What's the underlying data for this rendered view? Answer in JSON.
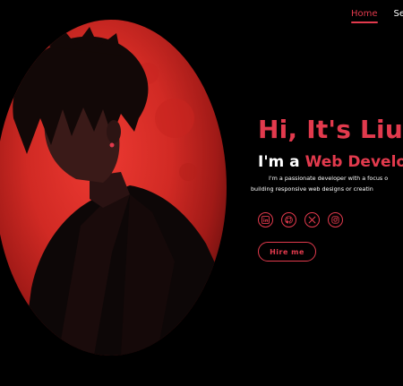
{
  "nav": {
    "items": [
      {
        "label": "Home",
        "active": true
      },
      {
        "label": "Ser",
        "active": false
      }
    ]
  },
  "hero": {
    "greeting": "Hi, It's Lius",
    "role_prefix": "I'm a ",
    "role": "Web Developer",
    "bio_line1": "I'm a passionate developer with a focus o",
    "bio_line2": "building responsive web designs or creatin",
    "hire_button": "Hire me"
  },
  "social": [
    {
      "icon": "linkedin-icon"
    },
    {
      "icon": "github-icon"
    },
    {
      "icon": "x-icon"
    },
    {
      "icon": "instagram-icon"
    }
  ],
  "colors": {
    "accent": "#e23a4d",
    "background": "#000000",
    "text": "#ffffff"
  }
}
